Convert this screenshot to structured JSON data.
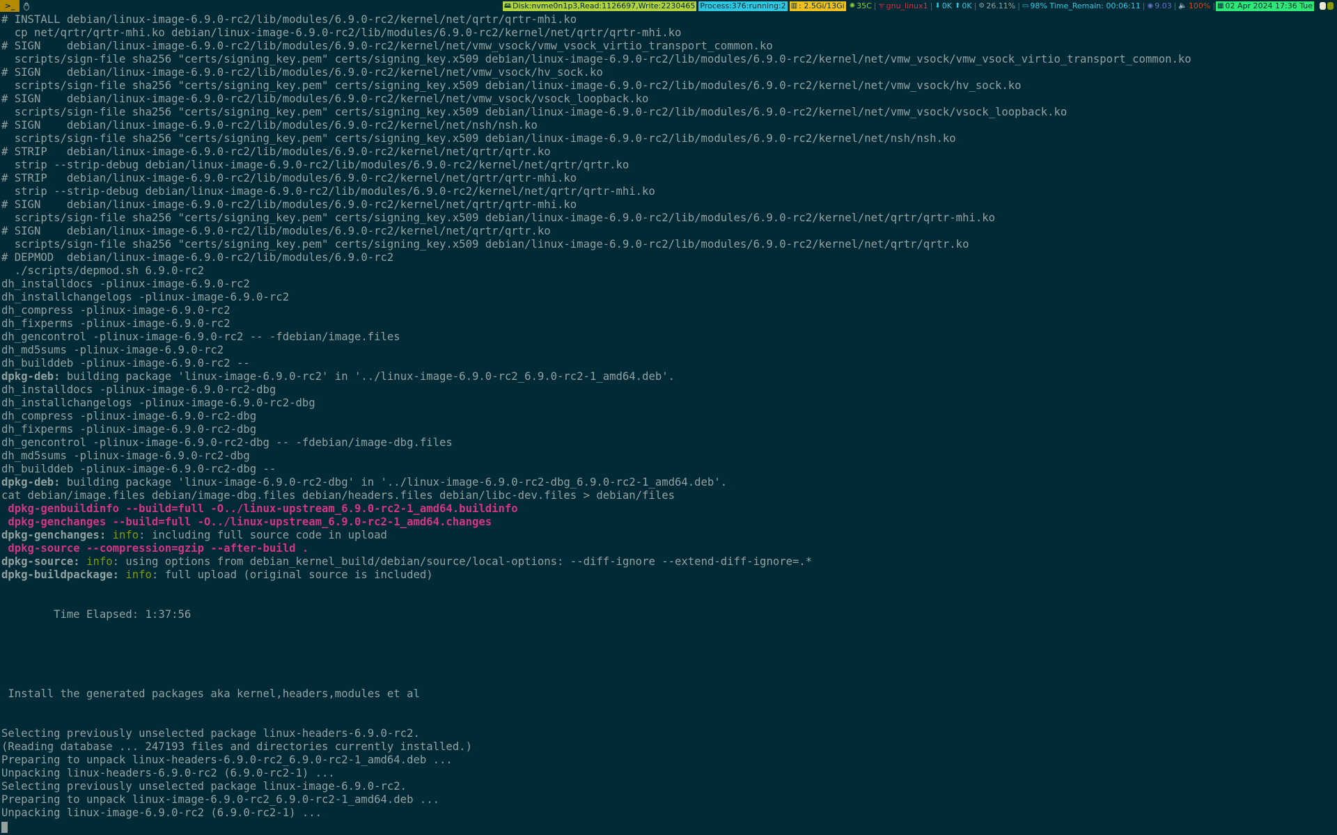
{
  "topbar": {
    "terminal_glyph": ">_",
    "tux_glyph": "🐧",
    "disk": "Disk:nvme0n1p3,Read:1126697,Write:2230465",
    "process": "Process:376:running:2",
    "memory": ": 2.5Gi/13Gi",
    "temp": "35C",
    "network_iface": "gnu_linux1",
    "net_down": "0K",
    "net_up": "0K",
    "cpu": "26.11%",
    "battery": "98% Time_Remain: 00:06:11",
    "load": "9.03",
    "volume": "100%",
    "datetime": "02 Apr 2024 17:36 Tue",
    "colors": {
      "disk_bg": "#b2d23e",
      "process_bg": "#2fc7e0",
      "memory_bg": "#f0c020",
      "temp_fg": "#8ad13a",
      "network_fg": "#e0303c",
      "net_fg": "#2fc7e0",
      "cpu_fg": "#93a1a1",
      "battery_fg": "#2fc7e0",
      "load_fg": "#6c71c4",
      "volume_fg": "#cb4b16",
      "datetime_bg": "#2ee878"
    },
    "icons": [
      "disk-icon",
      "memory-icon",
      "temp-icon",
      "wifi-icon",
      "download-icon",
      "upload-icon",
      "cpu-icon",
      "battery-icon",
      "load-icon",
      "volume-icon",
      "calendar-icon"
    ]
  },
  "terminal": {
    "lines": [
      {
        "s": [
          {
            "t": "# INSTALL debian/linux-image-6.9.0-rc2/lib/modules/6.9.0-rc2/kernel/net/qrtr/qrtr-mhi.ko",
            "c": "c-default"
          }
        ]
      },
      {
        "s": [
          {
            "t": "  cp net/qrtr/qrtr-mhi.ko debian/linux-image-6.9.0-rc2/lib/modules/6.9.0-rc2/kernel/net/qrtr/qrtr-mhi.ko",
            "c": "c-default"
          }
        ]
      },
      {
        "s": [
          {
            "t": "# SIGN    debian/linux-image-6.9.0-rc2/lib/modules/6.9.0-rc2/kernel/net/vmw_vsock/vmw_vsock_virtio_transport_common.ko",
            "c": "c-default"
          }
        ]
      },
      {
        "s": [
          {
            "t": "  scripts/sign-file sha256 \"certs/signing_key.pem\" certs/signing_key.x509 debian/linux-image-6.9.0-rc2/lib/modules/6.9.0-rc2/kernel/net/vmw_vsock/vmw_vsock_virtio_transport_common.ko",
            "c": "c-default"
          }
        ]
      },
      {
        "s": [
          {
            "t": "# SIGN    debian/linux-image-6.9.0-rc2/lib/modules/6.9.0-rc2/kernel/net/vmw_vsock/hv_sock.ko",
            "c": "c-default"
          }
        ]
      },
      {
        "s": [
          {
            "t": "  scripts/sign-file sha256 \"certs/signing_key.pem\" certs/signing_key.x509 debian/linux-image-6.9.0-rc2/lib/modules/6.9.0-rc2/kernel/net/vmw_vsock/hv_sock.ko",
            "c": "c-default"
          }
        ]
      },
      {
        "s": [
          {
            "t": "# SIGN    debian/linux-image-6.9.0-rc2/lib/modules/6.9.0-rc2/kernel/net/vmw_vsock/vsock_loopback.ko",
            "c": "c-default"
          }
        ]
      },
      {
        "s": [
          {
            "t": "  scripts/sign-file sha256 \"certs/signing_key.pem\" certs/signing_key.x509 debian/linux-image-6.9.0-rc2/lib/modules/6.9.0-rc2/kernel/net/vmw_vsock/vsock_loopback.ko",
            "c": "c-default"
          }
        ]
      },
      {
        "s": [
          {
            "t": "# SIGN    debian/linux-image-6.9.0-rc2/lib/modules/6.9.0-rc2/kernel/net/nsh/nsh.ko",
            "c": "c-default"
          }
        ]
      },
      {
        "s": [
          {
            "t": "  scripts/sign-file sha256 \"certs/signing_key.pem\" certs/signing_key.x509 debian/linux-image-6.9.0-rc2/lib/modules/6.9.0-rc2/kernel/net/nsh/nsh.ko",
            "c": "c-default"
          }
        ]
      },
      {
        "s": [
          {
            "t": "# STRIP   debian/linux-image-6.9.0-rc2/lib/modules/6.9.0-rc2/kernel/net/qrtr/qrtr.ko",
            "c": "c-default"
          }
        ]
      },
      {
        "s": [
          {
            "t": "  strip --strip-debug debian/linux-image-6.9.0-rc2/lib/modules/6.9.0-rc2/kernel/net/qrtr/qrtr.ko",
            "c": "c-default"
          }
        ]
      },
      {
        "s": [
          {
            "t": "# STRIP   debian/linux-image-6.9.0-rc2/lib/modules/6.9.0-rc2/kernel/net/qrtr/qrtr-mhi.ko",
            "c": "c-default"
          }
        ]
      },
      {
        "s": [
          {
            "t": "  strip --strip-debug debian/linux-image-6.9.0-rc2/lib/modules/6.9.0-rc2/kernel/net/qrtr/qrtr-mhi.ko",
            "c": "c-default"
          }
        ]
      },
      {
        "s": [
          {
            "t": "# SIGN    debian/linux-image-6.9.0-rc2/lib/modules/6.9.0-rc2/kernel/net/qrtr/qrtr-mhi.ko",
            "c": "c-default"
          }
        ]
      },
      {
        "s": [
          {
            "t": "  scripts/sign-file sha256 \"certs/signing_key.pem\" certs/signing_key.x509 debian/linux-image-6.9.0-rc2/lib/modules/6.9.0-rc2/kernel/net/qrtr/qrtr-mhi.ko",
            "c": "c-default"
          }
        ]
      },
      {
        "s": [
          {
            "t": "# SIGN    debian/linux-image-6.9.0-rc2/lib/modules/6.9.0-rc2/kernel/net/qrtr/qrtr.ko",
            "c": "c-default"
          }
        ]
      },
      {
        "s": [
          {
            "t": "  scripts/sign-file sha256 \"certs/signing_key.pem\" certs/signing_key.x509 debian/linux-image-6.9.0-rc2/lib/modules/6.9.0-rc2/kernel/net/qrtr/qrtr.ko",
            "c": "c-default"
          }
        ]
      },
      {
        "s": [
          {
            "t": "# DEPMOD  debian/linux-image-6.9.0-rc2/lib/modules/6.9.0-rc2",
            "c": "c-default"
          }
        ]
      },
      {
        "s": [
          {
            "t": "  ./scripts/depmod.sh 6.9.0-rc2",
            "c": "c-default"
          }
        ]
      },
      {
        "s": [
          {
            "t": "dh_installdocs -plinux-image-6.9.0-rc2",
            "c": "c-default"
          }
        ]
      },
      {
        "s": [
          {
            "t": "dh_installchangelogs -plinux-image-6.9.0-rc2",
            "c": "c-default"
          }
        ]
      },
      {
        "s": [
          {
            "t": "dh_compress -plinux-image-6.9.0-rc2",
            "c": "c-default"
          }
        ]
      },
      {
        "s": [
          {
            "t": "dh_fixperms -plinux-image-6.9.0-rc2",
            "c": "c-default"
          }
        ]
      },
      {
        "s": [
          {
            "t": "dh_gencontrol -plinux-image-6.9.0-rc2 -- -fdebian/image.files",
            "c": "c-default"
          }
        ]
      },
      {
        "s": [
          {
            "t": "dh_md5sums -plinux-image-6.9.0-rc2",
            "c": "c-default"
          }
        ]
      },
      {
        "s": [
          {
            "t": "dh_builddeb -plinux-image-6.9.0-rc2 --",
            "c": "c-default"
          }
        ]
      },
      {
        "s": [
          {
            "t": "dpkg-deb:",
            "c": "k-bold"
          },
          {
            "t": " building package 'linux-image-6.9.0-rc2' in '../linux-image-6.9.0-rc2_6.9.0-rc2-1_amd64.deb'.",
            "c": "k-rest"
          }
        ]
      },
      {
        "s": [
          {
            "t": "dh_installdocs -plinux-image-6.9.0-rc2-dbg",
            "c": "c-default"
          }
        ]
      },
      {
        "s": [
          {
            "t": "dh_installchangelogs -plinux-image-6.9.0-rc2-dbg",
            "c": "c-default"
          }
        ]
      },
      {
        "s": [
          {
            "t": "dh_compress -plinux-image-6.9.0-rc2-dbg",
            "c": "c-default"
          }
        ]
      },
      {
        "s": [
          {
            "t": "dh_fixperms -plinux-image-6.9.0-rc2-dbg",
            "c": "c-default"
          }
        ]
      },
      {
        "s": [
          {
            "t": "dh_gencontrol -plinux-image-6.9.0-rc2-dbg -- -fdebian/image-dbg.files",
            "c": "c-default"
          }
        ]
      },
      {
        "s": [
          {
            "t": "dh_md5sums -plinux-image-6.9.0-rc2-dbg",
            "c": "c-default"
          }
        ]
      },
      {
        "s": [
          {
            "t": "dh_builddeb -plinux-image-6.9.0-rc2-dbg --",
            "c": "c-default"
          }
        ]
      },
      {
        "s": [
          {
            "t": "dpkg-deb:",
            "c": "k-bold"
          },
          {
            "t": " building package 'linux-image-6.9.0-rc2-dbg' in '../linux-image-6.9.0-rc2-dbg_6.9.0-rc2-1_amd64.deb'.",
            "c": "k-rest"
          }
        ]
      },
      {
        "s": [
          {
            "t": "cat debian/image.files debian/image-dbg.files debian/headers.files debian/libc-dev.files > debian/files",
            "c": "c-default"
          }
        ]
      },
      {
        "s": [
          {
            "t": " dpkg-genbuildinfo --build=full -O../linux-upstream_6.9.0-rc2-1_amd64.buildinfo",
            "c": "c-magenta"
          }
        ]
      },
      {
        "s": [
          {
            "t": " dpkg-genchanges --build=full -O../linux-upstream_6.9.0-rc2-1_amd64.changes",
            "c": "c-magenta"
          }
        ]
      },
      {
        "s": [
          {
            "t": "dpkg-genchanges:",
            "c": "k-bold"
          },
          {
            "t": " ",
            "c": "k-rest"
          },
          {
            "t": "info",
            "c": "k-info"
          },
          {
            "t": ": including full source code in upload",
            "c": "k-rest"
          }
        ]
      },
      {
        "s": [
          {
            "t": " dpkg-source --compression=gzip --after-build .",
            "c": "c-magenta"
          }
        ]
      },
      {
        "s": [
          {
            "t": "dpkg-source:",
            "c": "k-bold"
          },
          {
            "t": " ",
            "c": "k-rest"
          },
          {
            "t": "info",
            "c": "k-info"
          },
          {
            "t": ": using options from debian_kernel_build/debian/source/local-options: --diff-ignore --extend-diff-ignore=.*",
            "c": "k-rest"
          }
        ]
      },
      {
        "s": [
          {
            "t": "dpkg-buildpackage:",
            "c": "k-bold"
          },
          {
            "t": " ",
            "c": "k-rest"
          },
          {
            "t": "info",
            "c": "k-info"
          },
          {
            "t": ": full upload (original source is included)",
            "c": "k-rest"
          }
        ]
      },
      {
        "s": [
          {
            "t": "",
            "c": "c-default"
          }
        ]
      },
      {
        "s": [
          {
            "t": "",
            "c": "c-default"
          }
        ]
      },
      {
        "s": [
          {
            "t": "        Time Elapsed: 1:37:56",
            "c": "c-default"
          }
        ]
      },
      {
        "s": [
          {
            "t": "",
            "c": "c-default"
          }
        ]
      },
      {
        "s": [
          {
            "t": "",
            "c": "c-default"
          }
        ]
      },
      {
        "s": [
          {
            "t": "",
            "c": "c-default"
          }
        ]
      },
      {
        "s": [
          {
            "t": "",
            "c": "c-default"
          }
        ]
      },
      {
        "s": [
          {
            "t": "",
            "c": "c-default"
          }
        ]
      },
      {
        "s": [
          {
            "t": " Install the generated packages aka kernel,headers,modules et al",
            "c": "c-default"
          }
        ]
      },
      {
        "s": [
          {
            "t": "",
            "c": "c-default"
          }
        ]
      },
      {
        "s": [
          {
            "t": "",
            "c": "c-default"
          }
        ]
      },
      {
        "s": [
          {
            "t": "Selecting previously unselected package linux-headers-6.9.0-rc2.",
            "c": "c-default"
          }
        ]
      },
      {
        "s": [
          {
            "t": "(Reading database ... 247193 files and directories currently installed.)",
            "c": "c-default"
          }
        ]
      },
      {
        "s": [
          {
            "t": "Preparing to unpack linux-headers-6.9.0-rc2_6.9.0-rc2-1_amd64.deb ...",
            "c": "c-default"
          }
        ]
      },
      {
        "s": [
          {
            "t": "Unpacking linux-headers-6.9.0-rc2 (6.9.0-rc2-1) ...",
            "c": "c-default"
          }
        ]
      },
      {
        "s": [
          {
            "t": "Selecting previously unselected package linux-image-6.9.0-rc2.",
            "c": "c-default"
          }
        ]
      },
      {
        "s": [
          {
            "t": "Preparing to unpack linux-image-6.9.0-rc2_6.9.0-rc2-1_amd64.deb ...",
            "c": "c-default"
          }
        ]
      },
      {
        "s": [
          {
            "t": "Unpacking linux-image-6.9.0-rc2 (6.9.0-rc2-1) ...",
            "c": "c-default"
          }
        ]
      }
    ]
  }
}
